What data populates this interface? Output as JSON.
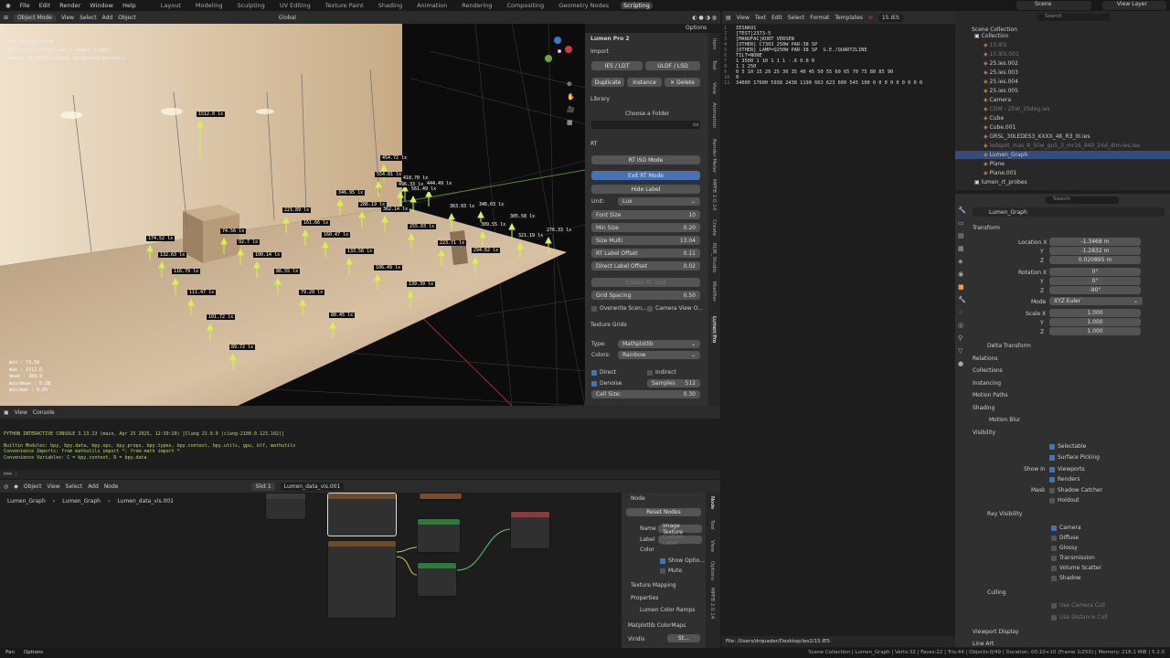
{
  "topbar": {
    "menus": [
      "File",
      "Edit",
      "Render",
      "Window",
      "Help"
    ],
    "workspaces": [
      "Layout",
      "Modeling",
      "Sculpting",
      "UV Editing",
      "Texture Paint",
      "Shading",
      "Animation",
      "Rendering",
      "Compositing",
      "Geometry Nodes",
      "Scripting"
    ],
    "active_workspace": "Scripting",
    "scene": "Scene",
    "view_layer": "View Layer"
  },
  "viewport": {
    "mode": "Object Mode",
    "menus": [
      "View",
      "Select",
      "Add",
      "Object"
    ],
    "transform": "Global",
    "options": "Options",
    "info": [
      "User Perspective",
      "(1) Scene Collection | Lumen_Graph",
      "Sample 60/1024 (Using optimized kernels)"
    ],
    "stats": [
      "min : 74.56",
      "max : 1512.0",
      "mean : 269.9",
      "min/mean : 0.28",
      "min/max : 0.05"
    ],
    "labels": [
      "1512.0 lx",
      "454.72 lx",
      "554.81 lx",
      "418.70 lx",
      "496.33 lx",
      "444.49 lx",
      "561.49 lx",
      "346.95 lx",
      "286.19 lx",
      "362.14 lx",
      "221.89 lx",
      "161.66 lx",
      "160.47 lx",
      "255.03 lx",
      "363.93 lx",
      "346.03 lx",
      "309.55 lx",
      "305.58 lx",
      "276.33 lx",
      "321.19 lx",
      "174.52 lx",
      "132.63 lx",
      "74.56 lx",
      "92.7 lx",
      "100.14 lx",
      "133.56 lx",
      "223.71 lx",
      "294.62 lx",
      "116.79 lx",
      "86.55 lx",
      "106.49 lx",
      "111.47 lx",
      "79.29 lx",
      "139.39 lx",
      "101.72 lx",
      "80.45 lx",
      "89.72 lx"
    ]
  },
  "npanel": {
    "title": "Lumen Pro 2",
    "import": "Import",
    "ies_ldt": "IES / LDT",
    "uldf": "ULDF / LSD",
    "duplicate": "Duplicate",
    "instance": "Instance",
    "delete": "Delete",
    "library": "Library",
    "choose_folder": "Choose a Folder",
    "rt": "RT",
    "rt_iso": "RT ISO Mode",
    "exit_rt": "Exit RT Mode",
    "hide_label": "Hide Label",
    "unit_label": "Unit:",
    "unit": "Lux",
    "fields": [
      {
        "k": "Font Size",
        "v": "10"
      },
      {
        "k": "Min Size",
        "v": "0.20"
      },
      {
        "k": "Size Multi",
        "v": "13.04"
      },
      {
        "k": "RT Label Offset",
        "v": "0.11"
      },
      {
        "k": "Direct Label Offset",
        "v": "0.02"
      }
    ],
    "create_grid": "Create RT Grid",
    "grid_spacing": "Grid Spacing",
    "grid_spacing_v": "0.50",
    "overwrite": "Overwrite Scen...",
    "camera_view": "Camera View O...",
    "texture_grids": "Texture Grids",
    "type_label": "Type:",
    "type": "Mathplotlib",
    "colors_label": "Colors:",
    "colors": "Rainbow",
    "direct": "Direct",
    "indirect": "Indirect",
    "denoise": "Denoise",
    "samples": "Samples",
    "samples_v": "512",
    "cell_size": "Cell Size:",
    "cell_size_v": "0.30",
    "tabs": [
      "Item",
      "Tool",
      "View",
      "Animation",
      "Render Meter",
      "MPFB 2.0.14",
      "Create",
      "RDR_Studio",
      "Modifier",
      "Lumen Pro"
    ]
  },
  "console": {
    "menus": [
      "View",
      "Console"
    ],
    "lines": [
      "PYTHON INTERACTIVE CONSOLE 3.13.13 (main, Apr 25 2025, 12:39:20) [Clang 21.0.0 (clang-2100.0.123.102)]",
      "",
      "Builtin Modules:      bpy, bpy.data, bpy.ops, bpy.props, bpy.types, bpy.context, bpy.utils, gpu, blf, mathutils",
      "Convenience Imports:  from mathutils import *; from math import *",
      "Convenience Variables: C = bpy.context, D = bpy.data"
    ],
    "prompt": ">>> "
  },
  "nodes": {
    "object": "Object",
    "menus": [
      "View",
      "Select",
      "Add",
      "Node"
    ],
    "slot": "Slot 1",
    "material": "Lumen_data_vis.001",
    "breadcrumb": [
      "Lumen_Graph",
      "Lumen_Graph",
      "Lumen_data_vis.001"
    ],
    "side": {
      "node": "Node",
      "reset": "Reset Nodes",
      "name_k": "Name",
      "name_v": "Image Texture",
      "label_k": "Label",
      "label_v": "Custom Label",
      "color_k": "Color",
      "show_options": "Show Optio...",
      "mute": "Mute",
      "texture_mapping": "Texture Mapping",
      "properties": "Properties",
      "ramps": "Lumen Color Ramps",
      "matplotlib": "Matplotlib ColorMaps",
      "viridis": "Viridis",
      "st": "St..."
    },
    "tabs": [
      "Node",
      "Tool",
      "View",
      "Options",
      "MPFB 2.0.14"
    ]
  },
  "text_editor": {
    "menus": [
      "View",
      "Text",
      "Edit",
      "Select",
      "Format",
      "Templates"
    ],
    "file": "15.IES",
    "lines": [
      "IESNA91",
      "[TEST]2373-5",
      "[MANUFAC]KURT VERSEN",
      "[OTHER] C7303 250W PAR-38 SP",
      "[OTHER] LAMP=Q250W PAR-38 SP  G.E./QUARTZLINE",
      "TILT=NONE",
      "1 3500 1 10 1 1 1 -.6 0.0 0",
      "1 1 250",
      "0 5 10 15 20 25 30 35 40 45 50 55 60 65 70 75 80 85 90",
      "0",
      "34000 17600 5938 2438 1190 663 623 600 545 100 0 0 0 0 0 0 0 0 0"
    ],
    "line_numbers": [
      "1",
      "2",
      "3",
      "4",
      "5",
      "6",
      "7",
      "8",
      "9",
      "10",
      "11"
    ],
    "status": "File: /Users/drquader/Desktop/ies2/15.IES"
  },
  "outliner": {
    "title": "Scene Collection",
    "search": "Search",
    "items": [
      {
        "n": "Collection",
        "d": 0
      },
      {
        "n": "15.IES",
        "d": 1,
        "dim": true
      },
      {
        "n": "15.IES.001",
        "d": 1,
        "dim": true
      },
      {
        "n": "25.ies.002",
        "d": 1
      },
      {
        "n": "25.ies.003",
        "d": 1
      },
      {
        "n": "25.ies.004",
        "d": 1
      },
      {
        "n": "25.ies.005",
        "d": 1
      },
      {
        "n": "Camera",
        "d": 1
      },
      {
        "n": "COM - 25W_25deg.ies",
        "d": 1,
        "dim": true
      },
      {
        "n": "Cube",
        "d": 1
      },
      {
        "n": "Cube.001",
        "d": 1
      },
      {
        "n": "GRSL_30LEDES3_XXXX_4K_R3_0I.ies",
        "d": 1
      },
      {
        "n": "ledspot_mas_8_50w_gu5_3_mr16_840_24d_dim-ies.ies",
        "d": 1,
        "dim": true
      },
      {
        "n": "Lumen_Graph",
        "d": 1,
        "sel": true
      },
      {
        "n": "Plane",
        "d": 1
      },
      {
        "n": "Plane.001",
        "d": 1
      },
      {
        "n": "lumen_rt_probes",
        "d": 0
      }
    ]
  },
  "properties": {
    "object": "Lumen_Graph",
    "search": "Search",
    "transform": "Transform",
    "location_label": "Location X",
    "loc": [
      "-1.3468 m",
      "-1.2832 m",
      "0.020895 m"
    ],
    "rotation_label": "Rotation X",
    "rot": [
      "0°",
      "0°",
      "-90°"
    ],
    "mode_label": "Mode",
    "mode": "XYZ Euler",
    "scale_label": "Scale X",
    "scale": [
      "1.000",
      "1.000",
      "1.000"
    ],
    "axis_y": "Y",
    "axis_z": "Z",
    "sections": [
      "Delta Transform",
      "Relations",
      "Collections",
      "Instancing",
      "Motion Paths",
      "Shading",
      "Motion Blur",
      "Visibility"
    ],
    "vis": {
      "selectable": "Selectable",
      "surface": "Surface Picking",
      "show_in": "Show In",
      "viewports": "Viewports",
      "renders": "Renders",
      "mask": "Mask",
      "shadow_catcher": "Shadow Catcher",
      "holdout": "Holdout",
      "ray": "Ray Visibility",
      "camera": "Camera",
      "diffuse": "Diffuse",
      "glossy": "Glossy",
      "transmission": "Transmission",
      "volume": "Volume Scatter",
      "shadow": "Shadow",
      "culling": "Culling",
      "use_camera": "Use Camera Cull",
      "use_distance": "Use Distance Cull",
      "viewport_display": "Viewport Display",
      "line_art": "Line Art"
    }
  },
  "statusbar": {
    "pan": "Pan",
    "options": "Options",
    "right": "Scene Collection | Lumen_Graph | Verts:32 | Faces:22 | Tris:44 | Objects:0/49 | Duration: 00:10+10 (Frame 1/250) | Memory: 216.1 MiB | 5.2.0"
  },
  "colors": {
    "accent": "#4772b3",
    "arrow": "#d7f24a",
    "wall": "#e4d3bd"
  }
}
